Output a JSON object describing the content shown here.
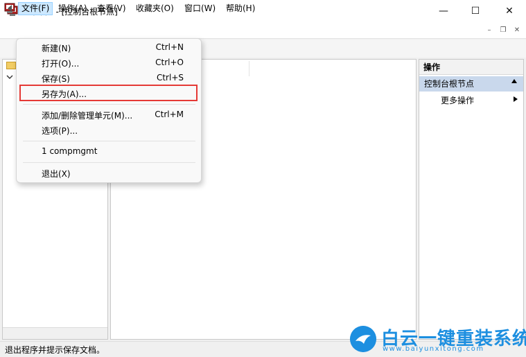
{
  "window": {
    "title": "控制台1 - [控制台根节点]",
    "controls": {
      "minimize": "—",
      "maximize": "☐",
      "close": "✕"
    }
  },
  "menubar": {
    "items": [
      "文件(F)",
      "操作(A)",
      "查看(V)",
      "收藏夹(O)",
      "窗口(W)",
      "帮助(H)"
    ],
    "active_index": 0,
    "mdi_controls": {
      "minimize": "–",
      "restore": "❐",
      "close": "✕"
    }
  },
  "file_menu": {
    "items": [
      {
        "label": "新建(N)",
        "shortcut": "Ctrl+N"
      },
      {
        "label": "打开(O)...",
        "shortcut": "Ctrl+O"
      },
      {
        "label": "保存(S)",
        "shortcut": "Ctrl+S"
      },
      {
        "label": "另存为(A)...",
        "shortcut": "",
        "highlighted": true
      },
      {
        "label": "添加/删除管理单元(M)...",
        "shortcut": "Ctrl+M"
      },
      {
        "label": "选项(P)...",
        "shortcut": ""
      },
      {
        "label": "1 compmgmt",
        "shortcut": ""
      },
      {
        "label": "退出(X)",
        "shortcut": ""
      }
    ],
    "highlight_color": "#e53935"
  },
  "actions_pane": {
    "header": "操作",
    "section": "控制台根节点",
    "item": "更多操作"
  },
  "statusbar": {
    "text": "退出程序并提示保存文档。"
  },
  "watermark": {
    "title": "白云一键重装系统",
    "url": "www.baiyunxitong.com",
    "color": "#1d8fe0"
  },
  "icons": {
    "app": "console-app-icon",
    "back": "back-arrow-icon",
    "tree_folder": "folder-icon",
    "tree_expand": "chevron-down-icon"
  }
}
